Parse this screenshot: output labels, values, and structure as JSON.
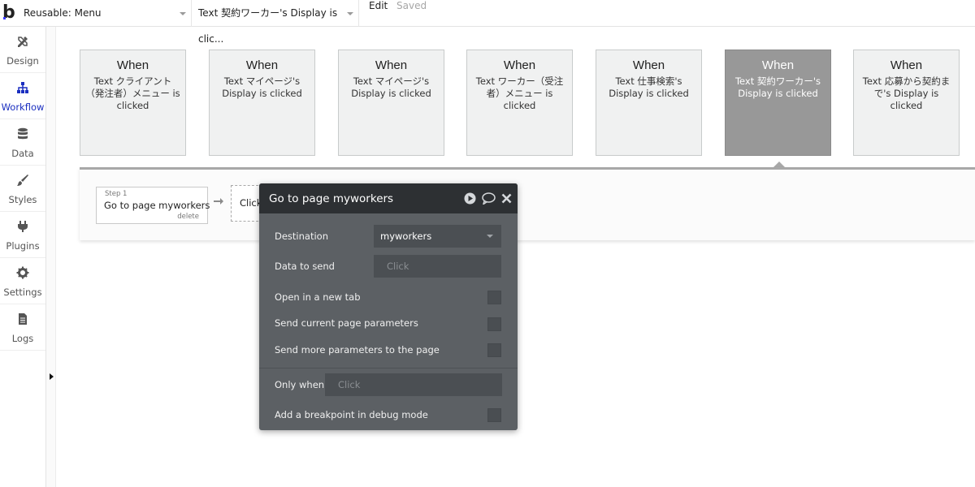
{
  "topbar": {
    "logo": "b",
    "page_selector": "Reusable: Menu",
    "event_selector": "Text 契約ワーカー's Display is clic...",
    "edit_label": "Edit",
    "saved_label": "Saved"
  },
  "nav": [
    {
      "label": "Design",
      "icon": "design-icon"
    },
    {
      "label": "Workflow",
      "icon": "workflow-icon",
      "active": true
    },
    {
      "label": "Data",
      "icon": "data-icon"
    },
    {
      "label": "Styles",
      "icon": "styles-icon"
    },
    {
      "label": "Plugins",
      "icon": "plugins-icon"
    },
    {
      "label": "Settings",
      "icon": "settings-icon"
    },
    {
      "label": "Logs",
      "icon": "logs-icon"
    }
  ],
  "events": [
    {
      "when": "When",
      "text": "Text クライアント（発注者）メニュー is clicked"
    },
    {
      "when": "When",
      "text": "Text マイページ's Display is clicked"
    },
    {
      "when": "When",
      "text": "Text マイページ's Display is clicked"
    },
    {
      "when": "When",
      "text": "Text ワーカー（受注者）メニュー is clicked"
    },
    {
      "when": "When",
      "text": "Text 仕事検索's Display is clicked"
    },
    {
      "when": "When",
      "text": "Text 契約ワーカー's Display is clicked",
      "active": true
    },
    {
      "when": "When",
      "text": "Text 応募から契約まで's Display is clicked"
    }
  ],
  "step": {
    "number": "Step 1",
    "name": "Go to page myworkers",
    "delete": "delete",
    "new_step": "Click"
  },
  "editor": {
    "title": "Go to page myworkers",
    "destination_label": "Destination",
    "destination_value": "myworkers",
    "data_to_send_label": "Data to send",
    "data_to_send_placeholder": "Click",
    "open_new_tab_label": "Open in a new tab",
    "send_params_label": "Send current page parameters",
    "send_more_label": "Send more parameters to the page",
    "only_when_label": "Only when",
    "only_when_placeholder": "Click",
    "breakpoint_label": "Add a breakpoint in debug mode"
  }
}
